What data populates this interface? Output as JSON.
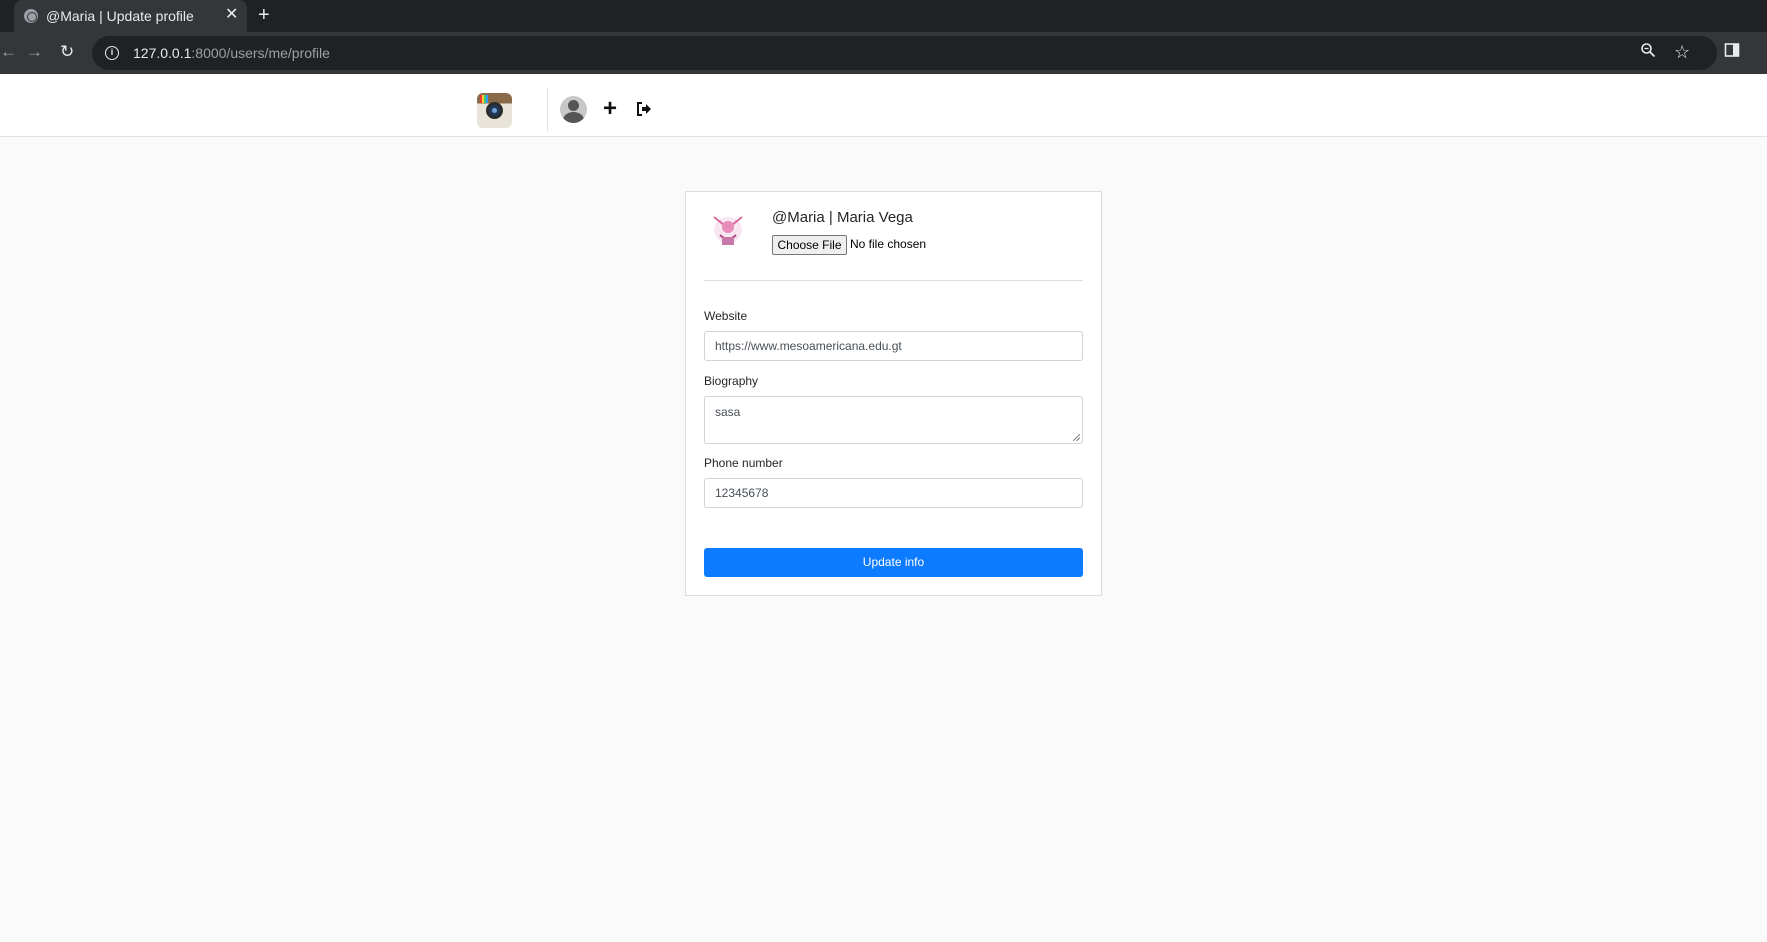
{
  "browser": {
    "tab_title": "@Maria | Update profile",
    "url_host": "127.0.0.1",
    "url_path": ":8000/users/me/profile"
  },
  "profile": {
    "heading": "@Maria | Maria Vega",
    "file_button_label": "Choose File",
    "file_status": "No file chosen"
  },
  "form": {
    "website_label": "Website",
    "website_value": "https://www.mesoamericana.edu.gt",
    "biography_label": "Biography",
    "biography_value": "sasa",
    "phone_label": "Phone number",
    "phone_value": "12345678",
    "submit_label": "Update info"
  },
  "icons": {
    "nav": [
      "camera-logo-icon",
      "avatar-icon",
      "plus-icon",
      "sign-out-icon"
    ],
    "browser": [
      "back-icon",
      "forward-icon",
      "reload-icon",
      "info-icon",
      "zoom-icon",
      "star-icon",
      "side-panel-icon"
    ]
  },
  "colors": {
    "primary_button": "#0d7bff",
    "page_background": "#fafafa",
    "browser_chrome": "#202124"
  }
}
